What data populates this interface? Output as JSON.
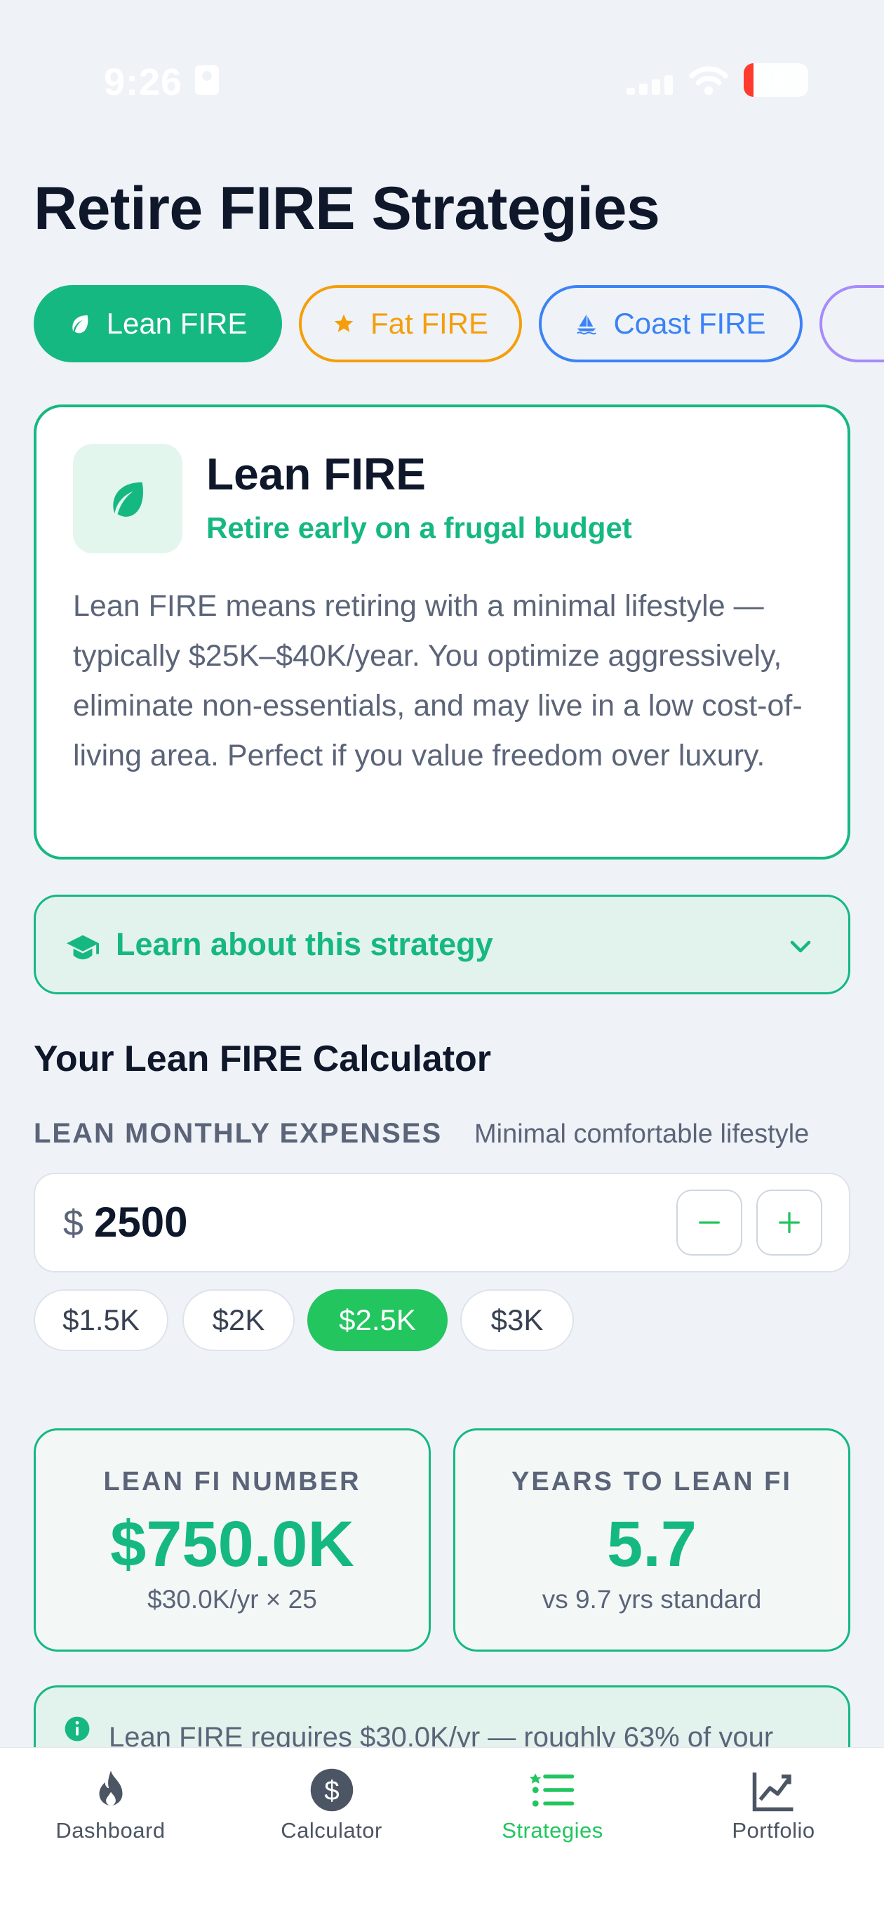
{
  "status_bar": {
    "time": "9:26",
    "battery": "10"
  },
  "page": {
    "title": "Retire FIRE Strategies"
  },
  "tabs": [
    {
      "label": "Lean FIRE",
      "icon": "leaf-icon",
      "color": "#16b882",
      "selected": true
    },
    {
      "label": "Fat FIRE",
      "icon": "star-icon",
      "color": "#f59e0b",
      "selected": false
    },
    {
      "label": "Coast FIRE",
      "icon": "sailboat-icon",
      "color": "#3b82f6",
      "selected": false
    }
  ],
  "strategy": {
    "title": "Lean FIRE",
    "subtitle": "Retire early on a frugal budget",
    "description": "Lean FIRE means retiring with a minimal lifestyle — typically $25K–$40K/year. You optimize aggressively, eliminate non-essentials, and may live in a low cost-of-living area. Perfect if you value freedom over luxury.",
    "icon": "leaf-icon"
  },
  "learn": {
    "label": "Learn about this strategy",
    "icon": "graduation-cap-icon"
  },
  "calculator": {
    "title": "Your Lean FIRE Calculator",
    "expenses_label": "LEAN MONTHLY EXPENSES",
    "expenses_hint": "Minimal comfortable lifestyle",
    "currency_symbol": "$",
    "expenses_value": "2500",
    "presets": [
      {
        "label": "$1.5K",
        "selected": false
      },
      {
        "label": "$2K",
        "selected": false
      },
      {
        "label": "$2.5K",
        "selected": true
      },
      {
        "label": "$3K",
        "selected": false
      }
    ]
  },
  "stats": {
    "fi_number": {
      "label": "LEAN FI NUMBER",
      "value": "$750.0K",
      "sub": "$30.0K/yr × 25"
    },
    "years": {
      "label": "YEARS TO LEAN FI",
      "value": "5.7",
      "sub": "vs 9.7 yrs standard"
    }
  },
  "info": {
    "text": "Lean FIRE requires $30.0K/yr — roughly 63% of your"
  },
  "nav": [
    {
      "label": "Dashboard",
      "icon": "flame-icon",
      "active": false
    },
    {
      "label": "Calculator",
      "icon": "dollar-icon",
      "active": false
    },
    {
      "label": "Strategies",
      "icon": "list-icon",
      "active": true
    },
    {
      "label": "Portfolio",
      "icon": "chart-line-icon",
      "active": false
    }
  ],
  "colors": {
    "accent": "#16b882",
    "active_preset": "#22c55e",
    "fat": "#f59e0b",
    "coast": "#3b82f6",
    "background": "#eff3f8"
  }
}
